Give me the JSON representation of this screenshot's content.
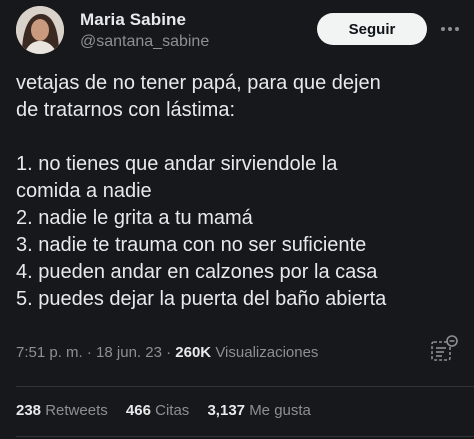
{
  "author": {
    "name": "Maria Sabine",
    "handle": "@santana_sabine"
  },
  "follow_button": {
    "label": "Seguir"
  },
  "tweet": {
    "lines": [
      "vetajas de no tener papá, para que dejen",
      "de tratarnos con lástima:",
      "",
      "1. no tienes que andar sirviendole la",
      "comida a nadie",
      "2. nadie le grita a tu mamá",
      "3. nadie te trauma con no ser suficiente",
      "4. pueden andar en calzones por la casa",
      "5. puedes dejar la puerta del baño abierta"
    ]
  },
  "meta": {
    "time": "7:51 p. m.",
    "sep1": "·",
    "date": "18 jun. 23",
    "sep2": "·",
    "views_count": "260K",
    "views_label": "Visualizaciones"
  },
  "stats": {
    "retweets_count": "238",
    "retweets_label": "Retweets",
    "quotes_count": "466",
    "quotes_label": "Citas",
    "likes_count": "3,137",
    "likes_label": "Me gusta"
  },
  "colors": {
    "background": "#16181b",
    "text_primary": "#e7e9ea",
    "text_secondary": "#8b9095",
    "button_bg": "#f2f3f3",
    "divider": "#2f3336"
  },
  "icons": {
    "more": "more-options-icon",
    "analytics": "analytics-icon"
  }
}
